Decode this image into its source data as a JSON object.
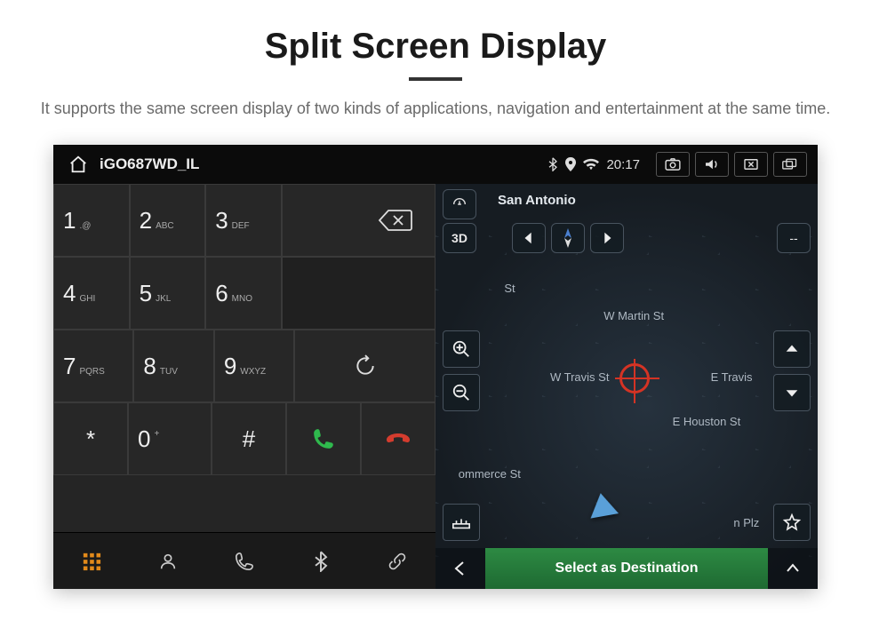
{
  "heading": "Split Screen Display",
  "subtitle": "It supports the same screen display of two kinds of applications, navigation and entertainment at the same time.",
  "statusbar": {
    "title": "iGO687WD_IL",
    "time": "20:17"
  },
  "keypad": {
    "r1": [
      {
        "num": "1",
        "letters": ".@"
      },
      {
        "num": "2",
        "letters": "ABC"
      },
      {
        "num": "3",
        "letters": "DEF"
      }
    ],
    "r2": [
      {
        "num": "4",
        "letters": "GHI"
      },
      {
        "num": "5",
        "letters": "JKL"
      },
      {
        "num": "6",
        "letters": "MNO"
      }
    ],
    "r3": [
      {
        "num": "7",
        "letters": "PQRS"
      },
      {
        "num": "8",
        "letters": "TUV"
      },
      {
        "num": "9",
        "letters": "WXYZ"
      }
    ],
    "r4": [
      {
        "num": "*",
        "letters": ""
      },
      {
        "num": "0",
        "letters": "+"
      },
      {
        "num": "#",
        "letters": ""
      }
    ]
  },
  "map": {
    "city": "San Antonio",
    "mode3d": "3D",
    "dash": "--",
    "streets": {
      "martin": "W Martin St",
      "travis": "W Travis St",
      "etravis": "E Travis",
      "ehouston": "E Houston St",
      "commerce": "ommerce St",
      "marketst": "St",
      "nplz": "n Plz"
    },
    "destination_label": "Select as Destination"
  }
}
